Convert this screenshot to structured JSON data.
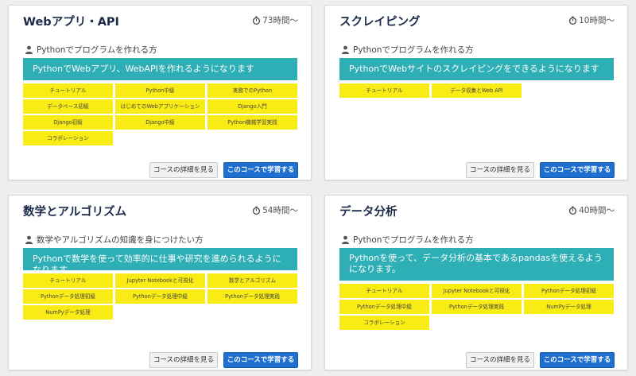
{
  "colors": {
    "banner": "#2eaeb5",
    "chip": "#f9eb14",
    "primary_button": "#1f6fd0",
    "title": "#1b2a4a"
  },
  "icons": {
    "time": "stopwatch-icon",
    "target": "person-icon"
  },
  "cards": [
    {
      "title": "Webアプリ・API",
      "time": "73時間〜",
      "target": "Pythonでプログラムを作れる方",
      "goal": "PythonでWebアプリ、WebAPIを作れるようになります",
      "chips": [
        "チュートリアル",
        "Python中級",
        "実務でのPython",
        "データベース初級",
        "はじめてのWebアプリケーション",
        "Django入門",
        "Django初級",
        "Django中級",
        "Python機械学習実践",
        "コラボレーション"
      ],
      "detail_button": "コースの詳細を見る",
      "study_button": "このコースで学習する"
    },
    {
      "title": "スクレイピング",
      "time": "10時間〜",
      "target": "Pythonでプログラムを作れる方",
      "goal": "PythonでWebサイトのスクレイピングをできるようになります",
      "chips": [
        "チュートリアル",
        "データ収集とWeb API"
      ],
      "detail_button": "コースの詳細を見る",
      "study_button": "このコースで学習する"
    },
    {
      "title": "数学とアルゴリズム",
      "time": "54時間〜",
      "target": "数学やアルゴリズムの知識を身につけたい方",
      "goal": "Pythonで数学を使って効率的に仕事や研究を進められるようになります",
      "chips": [
        "チュートリアル",
        "Jupyter Notebookと可視化",
        "数学とアルゴリズム",
        "Pythonデータ処理初級",
        "Pythonデータ処理中級",
        "Pythonデータ処理実践",
        "NumPyデータ処理"
      ],
      "detail_button": "コースの詳細を見る",
      "study_button": "このコースで学習する"
    },
    {
      "title": "データ分析",
      "time": "40時間〜",
      "target": "Pythonでプログラムを作れる方",
      "goal": "Pythonを使って、データ分析の基本であるpandasを使えるようになります。",
      "chips": [
        "チュートリアル",
        "Jupyter Notebookと可視化",
        "Pythonデータ処理初級",
        "Pythonデータ処理中級",
        "Pythonデータ処理実践",
        "NumPyデータ処理",
        "コラボレーション"
      ],
      "detail_button": "コースの詳細を見る",
      "study_button": "このコースで学習する"
    }
  ]
}
